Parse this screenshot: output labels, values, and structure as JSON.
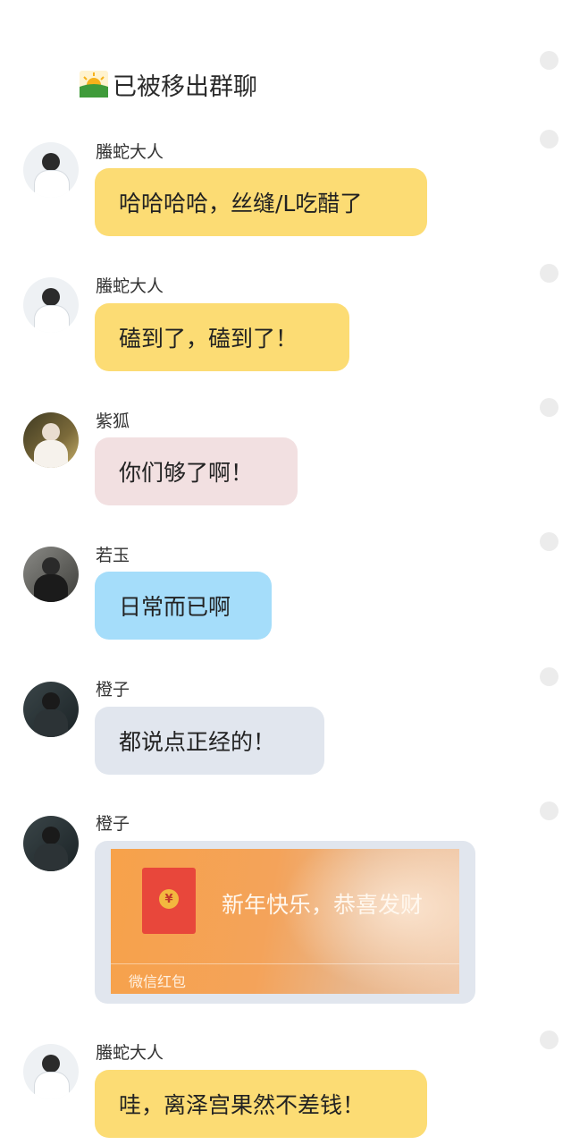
{
  "system_notice": {
    "text": "已被移出群聊",
    "icon": "sunrise-icon"
  },
  "messages": [
    {
      "sender": "螣蛇大人",
      "text": "哈哈哈哈，丝缝/L吃醋了",
      "bubble_color": "#fcdc74"
    },
    {
      "sender": "螣蛇大人",
      "text": "磕到了，磕到了！",
      "bubble_color": "#fcdc74"
    },
    {
      "sender": "紫狐",
      "text": "你们够了啊！",
      "bubble_color": "#f2e0e1"
    },
    {
      "sender": "若玉",
      "text": "日常而已啊",
      "bubble_color": "#a5ddfa"
    },
    {
      "sender": "橙子",
      "text": "都说点正经的！",
      "bubble_color": "#e1e6ee"
    },
    {
      "sender": "橙子",
      "red_packet": {
        "title": "新年快乐，恭喜发财",
        "label": "微信红包",
        "coin_symbol": "¥"
      }
    },
    {
      "sender": "螣蛇大人",
      "text": "哇，离泽宫果然不差钱！",
      "bubble_color": "#fcdc74"
    }
  ]
}
